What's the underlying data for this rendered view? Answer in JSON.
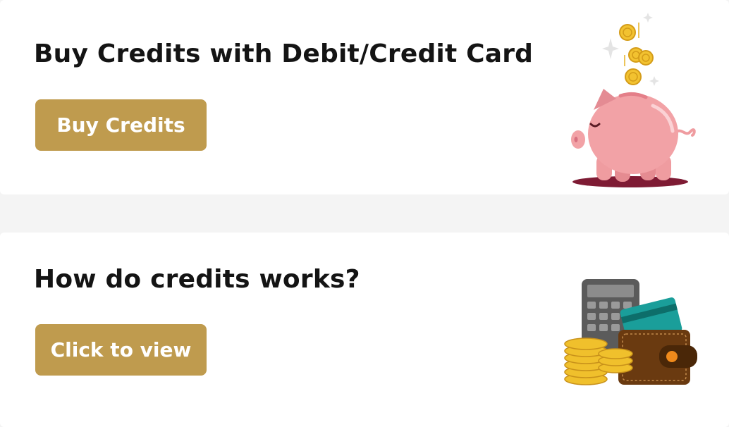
{
  "buy_section": {
    "title": "Buy Credits with Debit/Credit Card",
    "button_label": "Buy Credits",
    "illustration": "piggy-bank-coins-icon"
  },
  "how_section": {
    "title": "How do credits works?",
    "button_label": "Click to view",
    "illustration": "wallet-calculator-coins-icon"
  },
  "colors": {
    "button_bg": "#bf9b4e",
    "button_text": "#ffffff",
    "title_text": "#141414",
    "page_bg": "#f4f4f4",
    "card_bg": "#ffffff"
  }
}
